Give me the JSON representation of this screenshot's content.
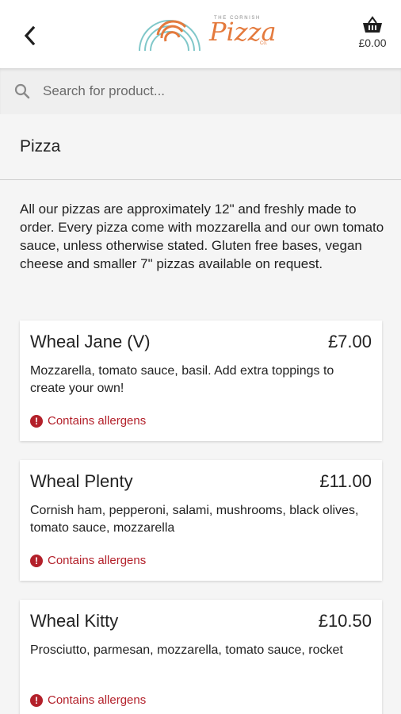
{
  "header": {
    "logo": {
      "tagline": "THE CORNISH",
      "word": "Pizza",
      "co": "Co."
    },
    "basket_total": "£0.00"
  },
  "search": {
    "placeholder": "Search for product..."
  },
  "category": {
    "title": "Pizza"
  },
  "intro": "All our pizzas are approximately 12\" and freshly made to order. Every pizza come with mozzarella and our own tomato sauce, unless otherwise stated. Gluten free bases, vegan cheese and smaller 7\" pizzas available on request.",
  "products": [
    {
      "name": "Wheal Jane (V)",
      "price": "£7.00",
      "description": "Mozzarella, tomato sauce, basil. Add extra toppings to create your own!",
      "allergen_label": "Contains allergens"
    },
    {
      "name": "Wheal Plenty",
      "price": "£11.00",
      "description": "Cornish ham, pepperoni, salami, mushrooms, black olives, tomato sauce, mozzarella",
      "allergen_label": "Contains allergens"
    },
    {
      "name": "Wheal Kitty",
      "price": "£10.50",
      "description": "Prosciutto, parmesan, mozzarella, tomato sauce, rocket",
      "allergen_label": "Contains allergens"
    }
  ],
  "colors": {
    "accent": "#e47a3d",
    "logo_teal": "#7fc7c9",
    "allergen": "#b3202a"
  }
}
